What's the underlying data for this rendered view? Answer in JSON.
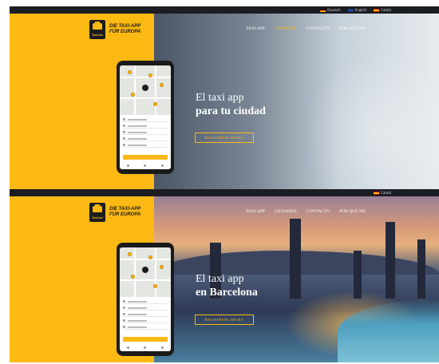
{
  "screens": [
    {
      "languages": [
        "Deutsch",
        "English",
        "Català"
      ],
      "logo": {
        "mark": "TaxiLine",
        "text_line1": "DIE TAXI-APP",
        "text_line2": "FÜR EUROPA"
      },
      "nav": [
        "TAXI APP",
        "CIUDADES",
        "CONTACTO",
        "POR QUE NO"
      ],
      "active_nav": "CIUDADES",
      "headline_line1": "El taxi app",
      "headline_line2": "para tu ciudad",
      "cta": "REGISTRESE AHORA"
    },
    {
      "languages": [
        "Català"
      ],
      "logo": {
        "mark": "TaxiLine",
        "text_line1": "DIE TAXI-APP",
        "text_line2": "FÜR EUROPA"
      },
      "nav": [
        "TAXI APP",
        "CIUDADES",
        "CONTACTO",
        "POR QUE NO"
      ],
      "headline_line1": "El taxi app",
      "headline_line2": "en Barcelona",
      "cta": "REGISTRESE AHORA"
    }
  ],
  "colors": {
    "brand_yellow": "#fdb913",
    "dark": "#1c1c1c",
    "topbar": "#1b1d22"
  }
}
